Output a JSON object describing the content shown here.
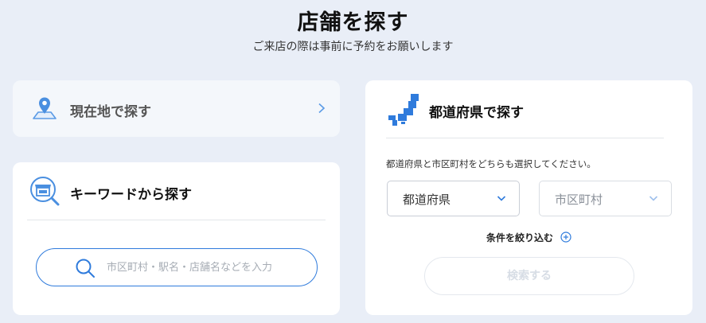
{
  "header": {
    "title": "店舗を探す",
    "subtitle": "ご来店の際は事前に予約をお願いします"
  },
  "location_card": {
    "label": "現在地で探す",
    "icon": "map-pin-icon"
  },
  "keyword_card": {
    "title": "キーワードから探す",
    "icon": "store-search-icon",
    "search": {
      "value": "",
      "placeholder": "市区町村・駅名・店舗名などを入力"
    }
  },
  "prefecture_card": {
    "title": "都道府県で探す",
    "icon": "japan-map-icon",
    "instruction": "都道府県と市区町村をどちらも選択してください。",
    "prefecture_select": {
      "selected": "都道府県"
    },
    "city_select": {
      "selected": "市区町村"
    },
    "narrow_label": "条件を絞り込む",
    "search_button": "検索する"
  },
  "colors": {
    "background": "#e9eef7",
    "accent": "#2f7bdc",
    "icon_blue": "#4a8fe0",
    "disabled_text": "#d7dde5"
  }
}
